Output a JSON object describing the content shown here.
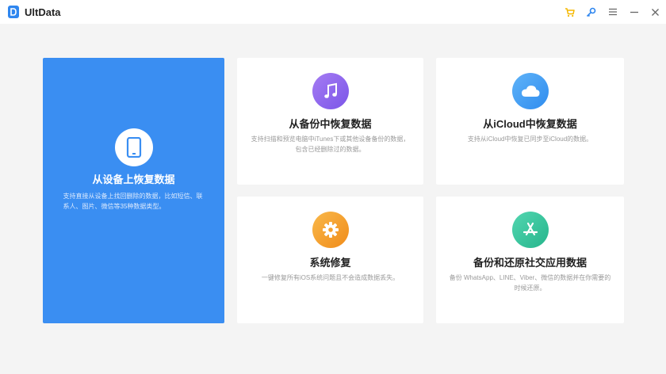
{
  "app": {
    "title": "UltData"
  },
  "titlebar": {
    "icons": [
      "cart-icon",
      "key-icon",
      "menu-icon",
      "minimize-icon",
      "close-icon"
    ]
  },
  "colors": {
    "primary_card": "#3a8ef2",
    "backup_icon": "#8b62ee",
    "icloud_icon": "#3f9cf4",
    "repair_icon": "#f5a02b",
    "social_icon": "#3cc7a0",
    "cart": "#f5b800",
    "key": "#2f86ef"
  },
  "cards": {
    "device": {
      "title": "从设备上恢复数据",
      "desc": "支持直接从设备上找回删除的数据，比如短信、联系人、图片、微信等35种数据类型。",
      "icon": "phone-icon"
    },
    "backup": {
      "title": "从备份中恢复数据",
      "desc": "支持扫描和预览电脑中iTunes下或其他设备备份的数据，包含已经删除过的数据。",
      "icon": "music-note-icon"
    },
    "icloud": {
      "title": "从iCloud中恢复数据",
      "desc": "支持从iCloud中恢复已同步至iCloud的数据。",
      "icon": "cloud-icon"
    },
    "repair": {
      "title": "系统修复",
      "desc": "一键修复所有iOS系统问题且不会造成数据丢失。",
      "icon": "gear-icon"
    },
    "social": {
      "title": "备份和还原社交应用数据",
      "desc": "备份 WhatsApp、LINE、Viber、微信的数据并在你需要的时候还原。",
      "icon": "app-store-icon"
    }
  }
}
